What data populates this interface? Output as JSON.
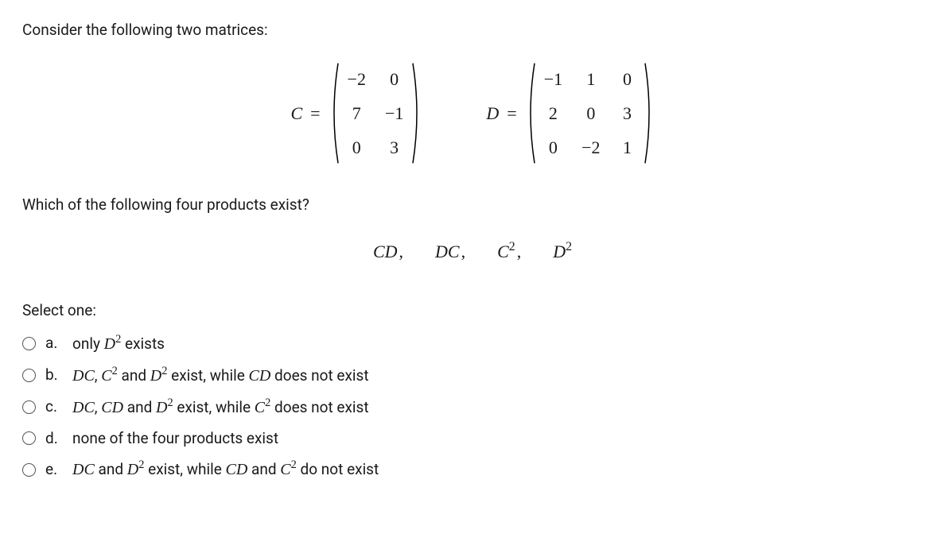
{
  "question": {
    "intro": "Consider the following two matrices:",
    "follow": "Which of the following four products exist?"
  },
  "matrixC": {
    "label": "C",
    "rows": [
      [
        "−2",
        "0"
      ],
      [
        "7",
        "−1"
      ],
      [
        "0",
        "3"
      ]
    ]
  },
  "matrixD": {
    "label": "D",
    "rows": [
      [
        "−1",
        "1",
        "0"
      ],
      [
        "2",
        "0",
        "3"
      ],
      [
        "0",
        "−2",
        "1"
      ]
    ]
  },
  "products": [
    "CD",
    "DC",
    "C2",
    "D2"
  ],
  "select_label": "Select one:",
  "options": {
    "a": {
      "letter": "a.",
      "pre": "only ",
      "m1": "D",
      "s1": "2",
      "post": " exists"
    },
    "b": {
      "letter": "b.",
      "m1": "DC",
      "sep1": ", ",
      "m2": "C",
      "s2": "2",
      "mid": " and ",
      "m3": "D",
      "s3": "2",
      "post": " exist, while ",
      "m4": "CD",
      "tail": " does not exist"
    },
    "c": {
      "letter": "c.",
      "m1": "DC",
      "sep1": ", ",
      "m2": "CD",
      "mid": " and ",
      "m3": "D",
      "s3": "2",
      "post": " exist, while ",
      "m4": "C",
      "s4": "2",
      "tail": " does not exist"
    },
    "d": {
      "letter": "d.",
      "text": "none of the four products exist"
    },
    "e": {
      "letter": "e.",
      "m1": "DC",
      "mid": " and ",
      "m2": "D",
      "s2": "2",
      "post": " exist, while ",
      "m3": "CD",
      "sep3": " and ",
      "m4": "C",
      "s4": "2",
      "tail": " do not exist"
    }
  }
}
